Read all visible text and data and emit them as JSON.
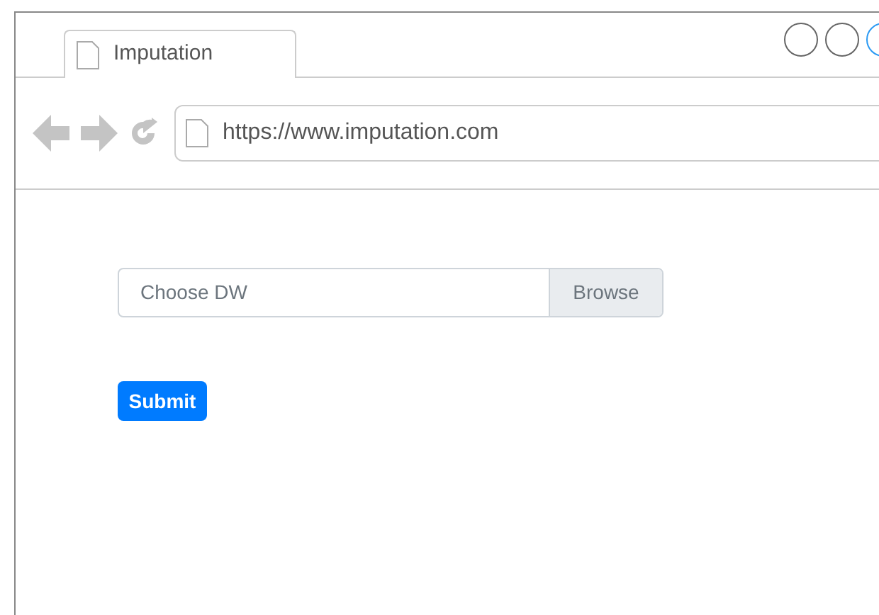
{
  "tab": {
    "title": "Imputation"
  },
  "address_bar": {
    "url": "https://www.imputation.com"
  },
  "file_input": {
    "placeholder": "Choose DW",
    "button": "Browse"
  },
  "submit_button": {
    "label": "Submit"
  }
}
